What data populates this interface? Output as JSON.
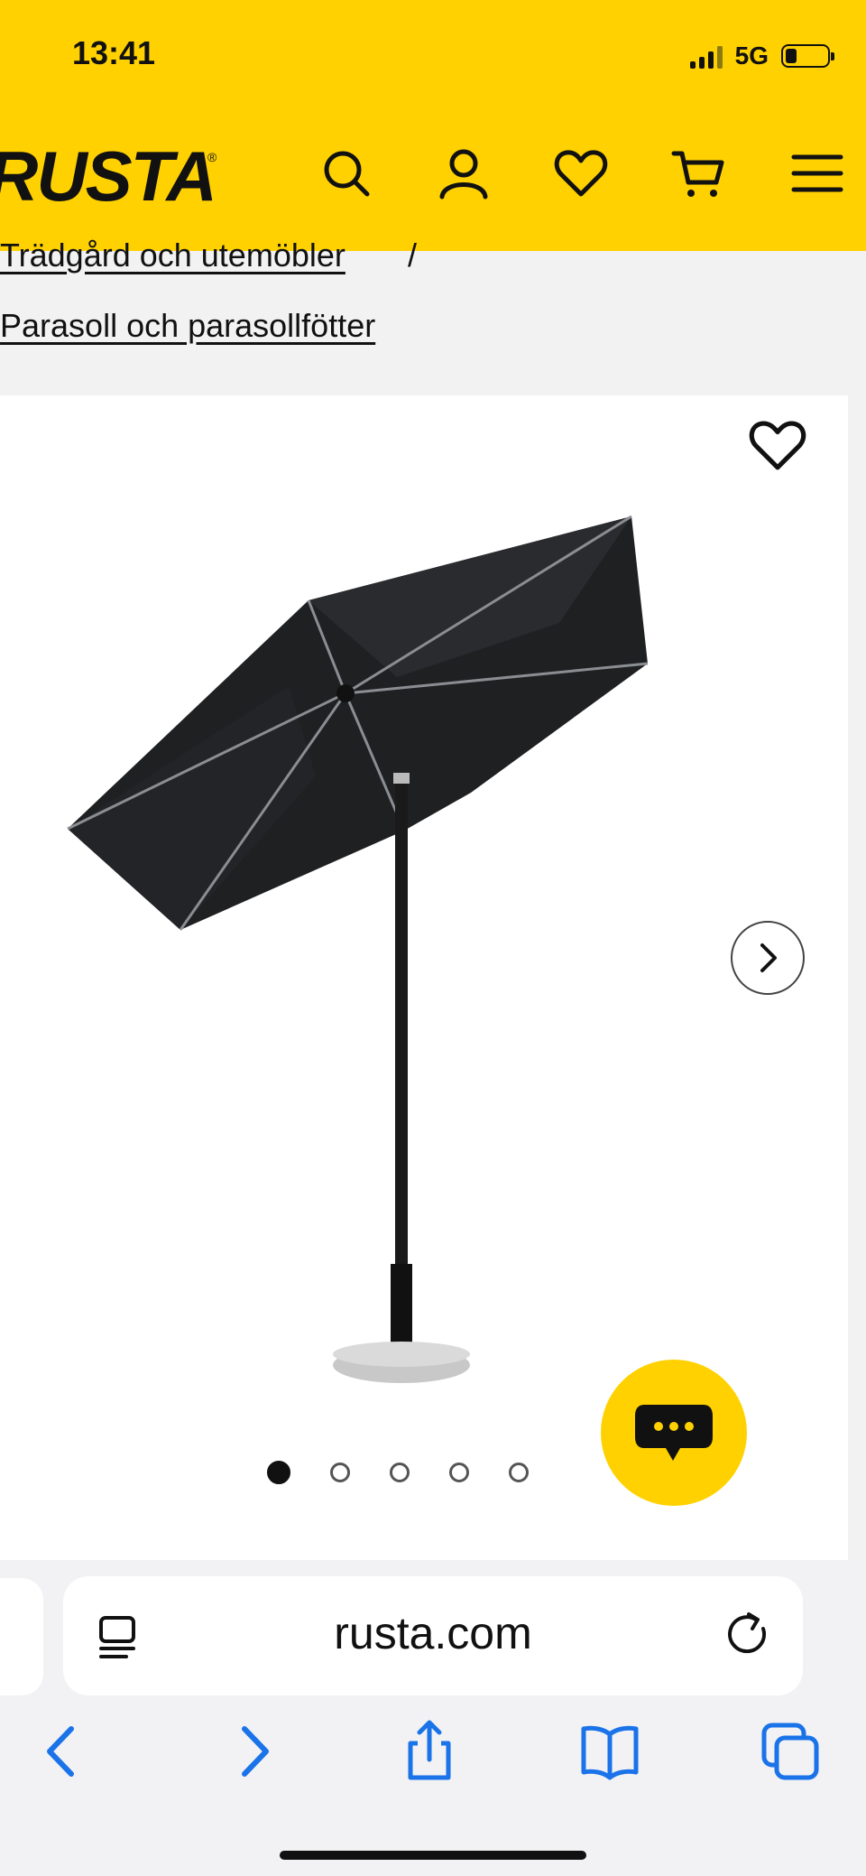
{
  "status_bar": {
    "time": "13:41",
    "network": "5G"
  },
  "header": {
    "logo_text": "RUSTA",
    "logo_mark": "®",
    "brand_color": "#ffd100",
    "icons": [
      "search-icon",
      "account-icon",
      "heart-icon",
      "cart-icon",
      "menu-icon"
    ]
  },
  "breadcrumb": {
    "item_1": "Trädgård och utemöbler",
    "separator": "/",
    "item_2": "Parasoll och parasollfötter"
  },
  "product": {
    "image_alt": "Black patio umbrella on granite base",
    "carousel": {
      "active_index": 1,
      "count": 5
    }
  },
  "browser": {
    "url": "rusta.com",
    "accent": "#1a73e8"
  }
}
